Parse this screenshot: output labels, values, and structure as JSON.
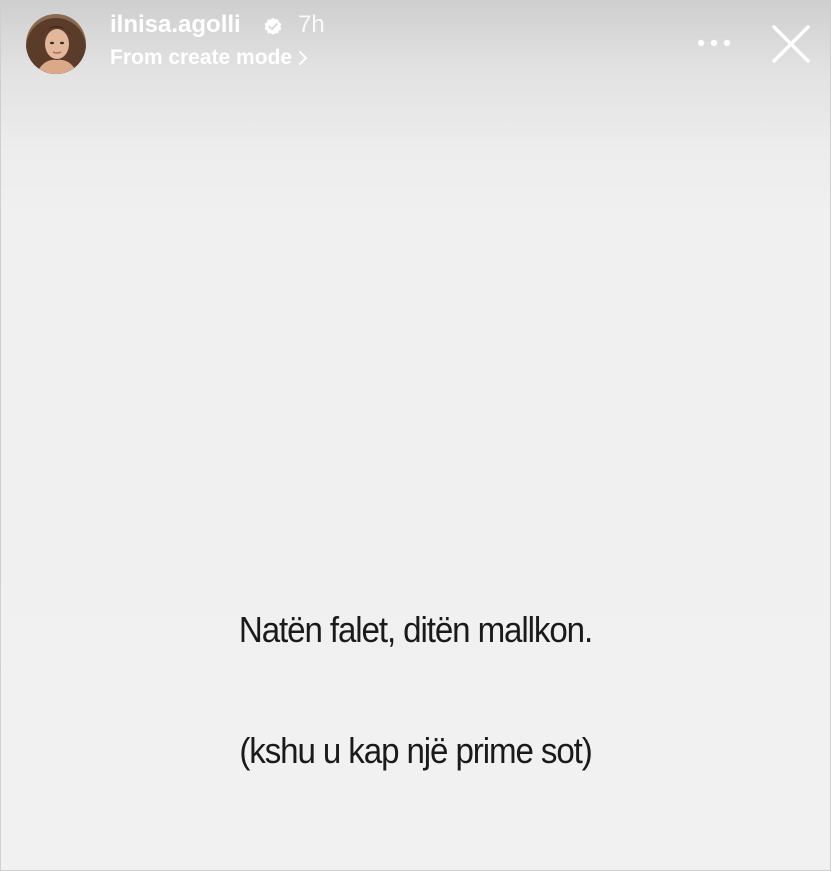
{
  "story": {
    "username": "ilnisa.agolli",
    "verified_icon": "verified-badge-icon",
    "time_ago": "7h",
    "subtitle": "From create mode",
    "subtitle_icon": "chevron-right-icon",
    "more_icon": "more-dots-icon",
    "close_icon": "close-icon"
  },
  "content": {
    "line1": "Natën falet, ditën mallkon.",
    "line2": "(kshu u kap një prime sot)"
  },
  "colors": {
    "background": "#f1f1f1",
    "header_text": "#ffffff",
    "caption_text": "#1a1a1a"
  }
}
